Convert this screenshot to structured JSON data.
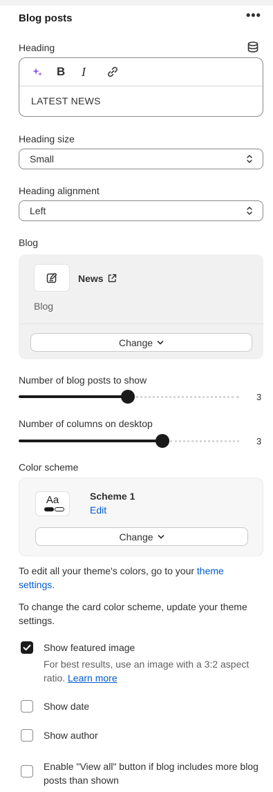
{
  "section": {
    "title": "Blog posts",
    "more_icon": "ellipsis-icon",
    "more_glyph": "•••"
  },
  "heading": {
    "label": "Heading",
    "source_icon": "database-icon",
    "toolbar": {
      "ai_icon": "sparkle-icon",
      "bold_glyph": "B",
      "italic_glyph": "I",
      "link_icon": "link-icon"
    },
    "value": "LATEST NEWS"
  },
  "heading_size": {
    "label": "Heading size",
    "selected": "Small"
  },
  "heading_alignment": {
    "label": "Heading alignment",
    "selected": "Left"
  },
  "blog": {
    "label": "Blog",
    "name": "News",
    "type": "Blog",
    "change_label": "Change"
  },
  "posts_to_show": {
    "label": "Number of blog posts to show",
    "value": "3",
    "fill_fraction": 0.5
  },
  "columns_desktop": {
    "label": "Number of columns on desktop",
    "value": "3",
    "fill_fraction": 0.66
  },
  "color_scheme": {
    "label": "Color scheme",
    "swatch_text": "Aa",
    "name": "Scheme 1",
    "edit_label": "Edit",
    "change_label": "Change"
  },
  "info": {
    "theme_colors_text": "To edit all your theme's colors, go to your",
    "theme_settings_link": "theme settings.",
    "card_scheme_text": "To change the card color scheme, update your theme settings."
  },
  "options": {
    "featured_image": {
      "label": "Show featured image",
      "checked": true,
      "help_text": "For best results, use an image with a 3:2 aspect ratio.",
      "learn_more": "Learn more"
    },
    "show_date": {
      "label": "Show date",
      "checked": false
    },
    "show_author": {
      "label": "Show author",
      "checked": false
    },
    "view_all": {
      "label": "Enable \"View all\" button if blog includes more blog posts than shown",
      "checked": false
    }
  },
  "colors": {
    "accent_link": "#005bd3",
    "ai_purple": "#8c5cf6",
    "dark": "#1a1a1a"
  }
}
